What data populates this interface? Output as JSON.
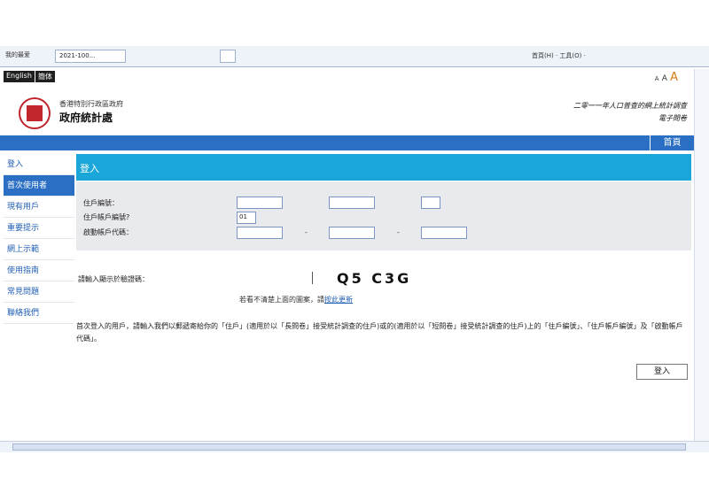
{
  "browser": {
    "favorites": "我的最爱",
    "tab_title": "2021-100...",
    "toolbar": "首頁(H) · 工具(O) ·"
  },
  "lang": {
    "english": "English",
    "simplified": "簡体"
  },
  "fontsize": {
    "small": "A",
    "mid": "A",
    "large": "A"
  },
  "header": {
    "dept_small": "香港特別行政區政府",
    "dept_big": "政府統計處",
    "census_title": "二零一一年人口普查的網上統計調查",
    "census_sub": "電子問卷",
    "home": "首頁"
  },
  "nav": {
    "items": [
      {
        "label": "登入",
        "active": false
      },
      {
        "label": "首次使用者",
        "active": true
      },
      {
        "label": "現有用戶",
        "active": false
      },
      {
        "label": "重要提示",
        "active": false
      },
      {
        "label": "網上示範",
        "active": false
      },
      {
        "label": "使用指南",
        "active": false
      },
      {
        "label": "常見問題",
        "active": false
      },
      {
        "label": "聯絡我們",
        "active": false
      }
    ]
  },
  "panel": {
    "title": "登入"
  },
  "form": {
    "label_household": "住戶編號：",
    "label_account": "住戶帳戶編號?",
    "label_activation": "啟動帳戶代碼：",
    "account_prefill": "01",
    "dash": "-"
  },
  "captcha": {
    "label": "請輸入顯示於驗證碼：",
    "image_text": "Q5 C3G",
    "help_prefix": "若看不清楚上面的圖案，請",
    "help_link": "按此更新"
  },
  "notice": "首次登入的用戶，請輸入我們以郵遞寄給你的「住戶」(適用於以「長問卷」接受統計調查的住戶)或的(適用於以「短問卷」接受統計調查的住戶)上的「住戶編號」、「住戶帳戶編號」及「啟動帳戶代碼」。",
  "login_button": "登入",
  "colors": {
    "blue": "#2a6fc4",
    "cyan": "#1aa6d8",
    "red": "#c0262c"
  }
}
